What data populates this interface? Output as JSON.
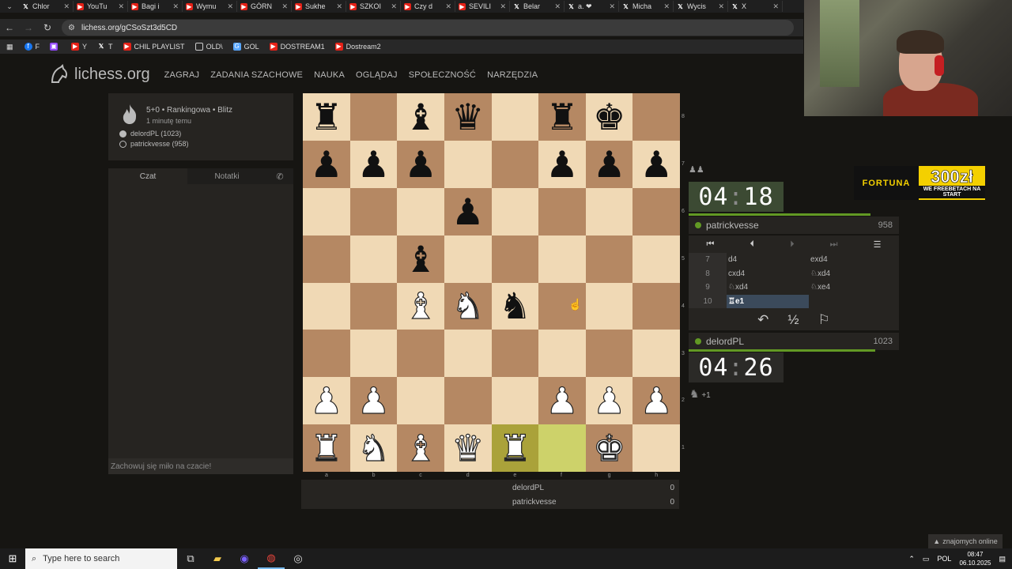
{
  "browser": {
    "tabs": [
      {
        "icon": "x",
        "label": "Chlor"
      },
      {
        "icon": "yt",
        "label": "YouTu"
      },
      {
        "icon": "yt",
        "label": "Bagi i"
      },
      {
        "icon": "yt",
        "label": "Wymu"
      },
      {
        "icon": "yt",
        "label": "GÓRN"
      },
      {
        "icon": "yt",
        "label": "Sukhe"
      },
      {
        "icon": "yt",
        "label": "SZKOI"
      },
      {
        "icon": "yt",
        "label": "Czy d"
      },
      {
        "icon": "yt",
        "label": "SEVILI"
      },
      {
        "icon": "x",
        "label": "Belar"
      },
      {
        "icon": "x",
        "label": "a. ❤"
      },
      {
        "icon": "x",
        "label": "Micha"
      },
      {
        "icon": "x",
        "label": "Wycis"
      },
      {
        "icon": "x",
        "label": "X"
      }
    ],
    "url": "lichess.org/gCSoSzt3d5CD",
    "bookmarks": [
      {
        "icon": "fb",
        "label": "F"
      },
      {
        "icon": "tw",
        "label": ""
      },
      {
        "icon": "yt",
        "label": "Y"
      },
      {
        "icon": "x",
        "label": "T"
      },
      {
        "icon": "yt",
        "label": "CHIL PLAYLIST"
      },
      {
        "icon": "folder",
        "label": "OLD\\"
      },
      {
        "icon": "g",
        "label": "GOL"
      },
      {
        "icon": "yt",
        "label": "DOSTREAM1"
      },
      {
        "icon": "yt",
        "label": "Dostream2"
      }
    ]
  },
  "site": {
    "logo": "lichess.org",
    "nav": [
      "ZAGRAJ",
      "ZADANIA SZACHOWE",
      "NAUKA",
      "OGLĄDAJ",
      "SPOŁECZNOŚĆ",
      "NARZĘDZIA"
    ]
  },
  "game_meta": {
    "type": "5+0 • Rankingowa • Blitz",
    "time": "1 minutę temu",
    "white": "delordPL (1023)",
    "black": "patrickvesse (958)"
  },
  "chat": {
    "tab_chat": "Czat",
    "tab_notes": "Notatki",
    "placeholder": "Zachowuj się miło na czacie!"
  },
  "board": {
    "ranks": [
      "8",
      "7",
      "6",
      "5",
      "4",
      "3",
      "2",
      "1"
    ],
    "files": [
      "a",
      "b",
      "c",
      "d",
      "e",
      "f",
      "g",
      "h"
    ],
    "squares": [
      [
        "bR",
        "",
        "bB",
        "bQ",
        "",
        "bR",
        "bK",
        ""
      ],
      [
        "bP",
        "bP",
        "bP",
        "",
        "",
        "bP",
        "bP",
        "bP"
      ],
      [
        "",
        "",
        "",
        "bP",
        "",
        "",
        "",
        ""
      ],
      [
        "",
        "",
        "bB",
        "",
        "",
        "",
        "",
        ""
      ],
      [
        "",
        "",
        "wB",
        "wN",
        "bN",
        "",
        "",
        ""
      ],
      [
        "",
        "",
        "",
        "",
        "",
        "",
        "",
        ""
      ],
      [
        "wP",
        "wP",
        "",
        "",
        "",
        "wP",
        "wP",
        "wP"
      ],
      [
        "wR",
        "wN",
        "wB",
        "wQ",
        "wR",
        "",
        "wK",
        ""
      ]
    ],
    "last_move": [
      "e1",
      "f1"
    ]
  },
  "scores": [
    {
      "name": "delordPL",
      "score": "0"
    },
    {
      "name": "patrickvesse",
      "score": "0"
    }
  ],
  "clocks": {
    "top": {
      "min": "04",
      "sec": "18"
    },
    "bottom": {
      "min": "04",
      "sec": "26"
    }
  },
  "players": {
    "top": {
      "name": "patrickvesse",
      "rating": "958"
    },
    "bottom": {
      "name": "delordPL",
      "rating": "1023"
    }
  },
  "moves": [
    {
      "n": "7",
      "w": "d4",
      "b": "exd4"
    },
    {
      "n": "8",
      "w": "cxd4",
      "b": "♘xd4"
    },
    {
      "n": "9",
      "w": "♘xd4",
      "b": "♘xe4"
    },
    {
      "n": "10",
      "w": "♖e1",
      "b": ""
    }
  ],
  "move_alert": "+1",
  "ad": {
    "brand": "FORTUNA",
    "amount": "300zł",
    "sub": "WE FREEBETACH NA START"
  },
  "online_friends": "znajomych online",
  "taskbar": {
    "search_placeholder": "Type here to search",
    "lang": "POL",
    "time": "08:47",
    "date": "06.10.2025"
  },
  "colors": {
    "accent_green": "#629924",
    "board_light": "#f0d9b5",
    "board_dark": "#b58863",
    "highlight": "#cdd26a"
  }
}
